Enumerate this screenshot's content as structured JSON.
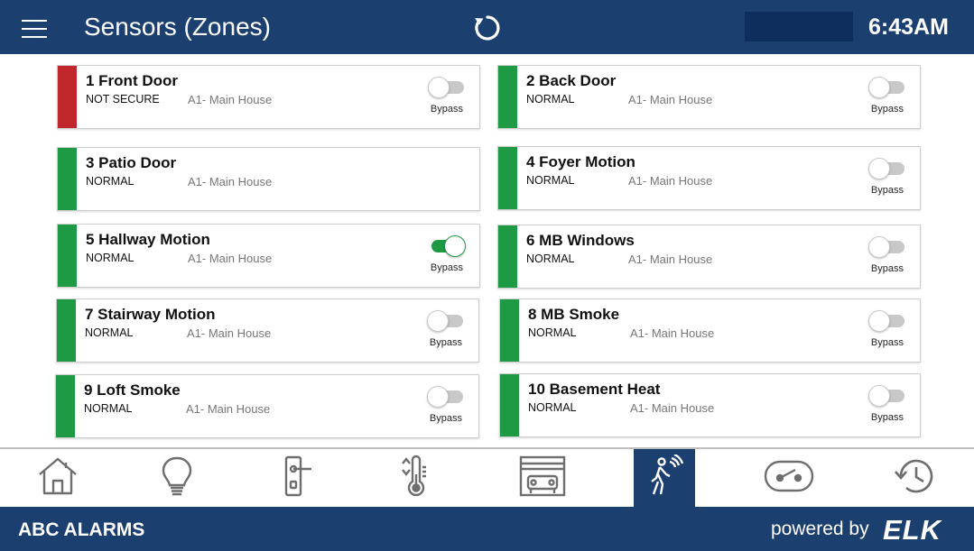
{
  "header": {
    "title": "Sensors (Zones)",
    "time": "6:43AM",
    "icons": {
      "menu": "hamburger-menu-icon",
      "refresh": "refresh-icon"
    }
  },
  "colors": {
    "header_bg": "#1b3f6e",
    "status_not_secure": "#c0272d",
    "status_normal": "#1e9a45",
    "toggle_on": "#1e9a45"
  },
  "zones": [
    {
      "name": "1 Front Door",
      "status": "NOT SECURE",
      "area": "A1- Main House",
      "bypass": false,
      "has_bypass": true,
      "bypass_label": "Bypass"
    },
    {
      "name": "2 Back Door",
      "status": "NORMAL",
      "area": "A1- Main House",
      "bypass": false,
      "has_bypass": true,
      "bypass_label": "Bypass"
    },
    {
      "name": "3 Patio Door",
      "status": "NORMAL",
      "area": "A1- Main House",
      "bypass": false,
      "has_bypass": false,
      "bypass_label": ""
    },
    {
      "name": "4 Foyer Motion",
      "status": "NORMAL",
      "area": "A1- Main House",
      "bypass": false,
      "has_bypass": true,
      "bypass_label": "Bypass"
    },
    {
      "name": "5 Hallway Motion",
      "status": "NORMAL",
      "area": "A1- Main House",
      "bypass": true,
      "has_bypass": true,
      "bypass_label": "Bypass"
    },
    {
      "name": "6 MB Windows",
      "status": "NORMAL",
      "area": "A1- Main House",
      "bypass": false,
      "has_bypass": true,
      "bypass_label": "Bypass"
    },
    {
      "name": "7 Stairway Motion",
      "status": "NORMAL",
      "area": "A1- Main House",
      "bypass": false,
      "has_bypass": true,
      "bypass_label": "Bypass"
    },
    {
      "name": "8 MB Smoke",
      "status": "NORMAL",
      "area": "A1- Main House",
      "bypass": false,
      "has_bypass": true,
      "bypass_label": "Bypass"
    },
    {
      "name": "9 Loft Smoke",
      "status": "NORMAL",
      "area": "A1- Main House",
      "bypass": false,
      "has_bypass": true,
      "bypass_label": "Bypass"
    },
    {
      "name": "10 Basement Heat",
      "status": "NORMAL",
      "area": "A1- Main House",
      "bypass": false,
      "has_bypass": true,
      "bypass_label": "Bypass"
    }
  ],
  "nav": {
    "items": [
      {
        "icon": "home-icon",
        "active": false
      },
      {
        "icon": "lightbulb-icon",
        "active": false
      },
      {
        "icon": "door-lock-icon",
        "active": false
      },
      {
        "icon": "thermostat-icon",
        "active": false
      },
      {
        "icon": "garage-icon",
        "active": false
      },
      {
        "icon": "motion-sensor-icon",
        "active": true
      },
      {
        "icon": "switch-icon",
        "active": false
      },
      {
        "icon": "history-icon",
        "active": false
      }
    ]
  },
  "footer": {
    "brand": "ABC ALARMS",
    "powered_by": "powered by",
    "logo_text": "ELK"
  }
}
